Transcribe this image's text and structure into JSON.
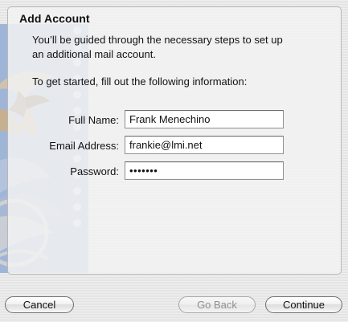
{
  "dialog": {
    "title": "Add Account",
    "intro_line_1": "You’ll be guided through the necessary steps to set up",
    "intro_line_2": "an additional mail account.",
    "instruction": "To get started, fill out the following information:"
  },
  "form": {
    "full_name": {
      "label": "Full Name:",
      "value": "Frank Menechino"
    },
    "email": {
      "label": "Email Address:",
      "value": "frankie@lmi.net"
    },
    "password": {
      "label": "Password:",
      "value": "•••••••"
    }
  },
  "buttons": {
    "cancel": "Cancel",
    "go_back": "Go Back",
    "continue": "Continue"
  },
  "icons": {
    "stamp": "postage-stamp-eagle-icon"
  },
  "colors": {
    "stamp_blue": "#9fb5d8",
    "eagle_brown": "#8a6d4e"
  }
}
